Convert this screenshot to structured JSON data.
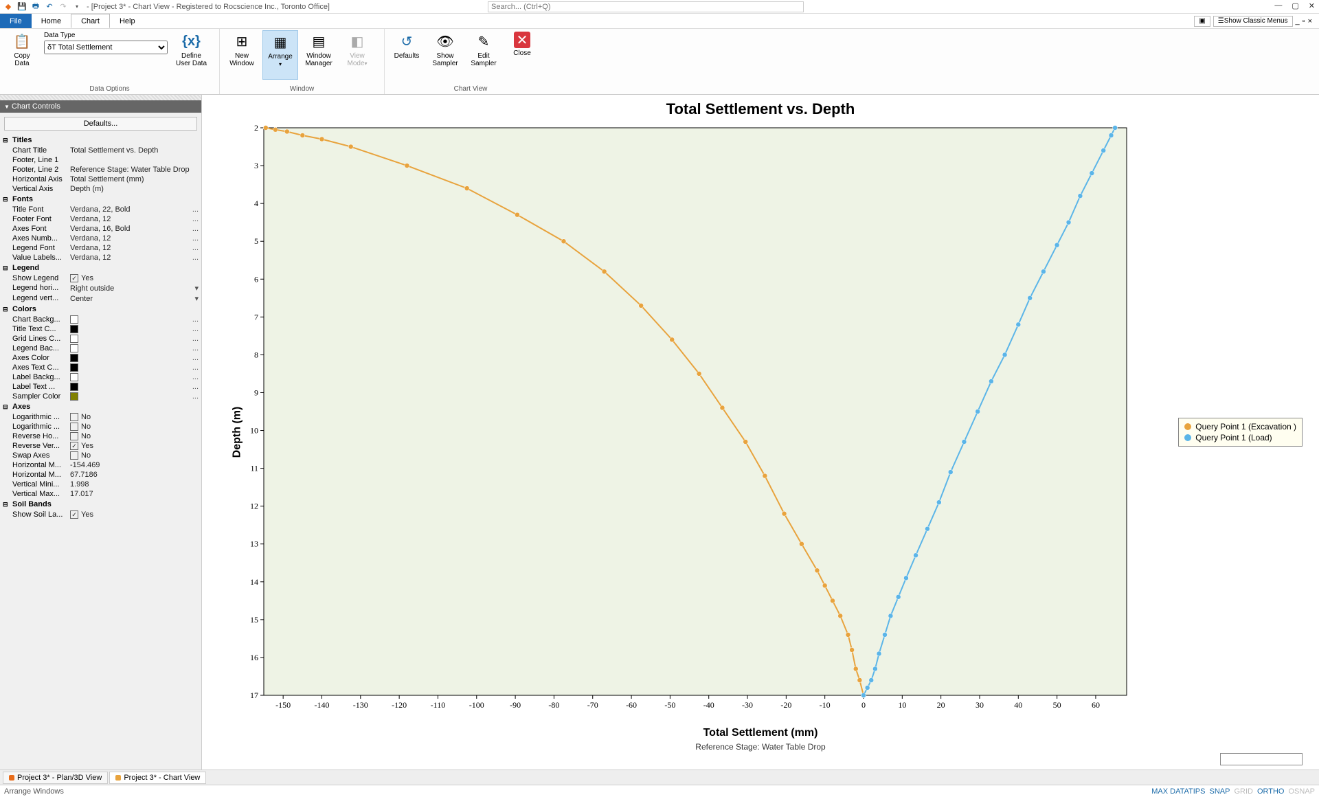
{
  "window": {
    "title": "- [Project 3* - Chart View - Registered to Rocscience Inc., Toronto Office]",
    "search_placeholder": "Search... (Ctrl+Q)"
  },
  "menu": {
    "file": "File",
    "home": "Home",
    "chart": "Chart",
    "help": "Help",
    "show_classic": "Show Classic Menus"
  },
  "ribbon": {
    "copy_data": "Copy\nData",
    "data_type_label": "Data Type",
    "data_type_value": "δT Total Settlement",
    "define_user": "Define\nUser Data",
    "group1": "Data Options",
    "new_window": "New\nWindow",
    "arrange": "Arrange",
    "window_manager": "Window\nManager",
    "view_mode": "View\nMode",
    "group2": "Window",
    "defaults": "Defaults",
    "show_sampler": "Show\nSampler",
    "edit_sampler": "Edit\nSampler",
    "close": "Close",
    "group3": "Chart View"
  },
  "sidebar": {
    "header": "Chart Controls",
    "defaults_btn": "Defaults...",
    "cats": {
      "titles": "Titles",
      "fonts": "Fonts",
      "legend": "Legend",
      "colors": "Colors",
      "axes": "Axes",
      "soil": "Soil Bands"
    },
    "titles": {
      "chart_title_k": "Chart Title",
      "chart_title_v": "Total Settlement vs. Depth",
      "footer1_k": "Footer, Line 1",
      "footer1_v": "",
      "footer2_k": "Footer, Line 2",
      "footer2_v": "Reference Stage: Water Table Drop",
      "haxis_k": "Horizontal Axis",
      "haxis_v": "Total Settlement (mm)",
      "vaxis_k": "Vertical Axis",
      "vaxis_v": "Depth (m)"
    },
    "fonts": {
      "title_k": "Title Font",
      "title_v": "Verdana, 22, Bold",
      "footer_k": "Footer Font",
      "footer_v": "Verdana, 12",
      "axes_k": "Axes Font",
      "axes_v": "Verdana, 16, Bold",
      "nums_k": "Axes Numb...",
      "nums_v": "Verdana, 12",
      "legend_k": "Legend Font",
      "legend_v": "Verdana, 12",
      "vals_k": "Value Labels...",
      "vals_v": "Verdana, 12"
    },
    "legend": {
      "show_k": "Show Legend",
      "show_v": "Yes",
      "horiz_k": "Legend hori...",
      "horiz_v": "Right outside",
      "vert_k": "Legend vert...",
      "vert_v": "Center"
    },
    "colors": {
      "bg_k": "Chart Backg...",
      "title_k": "Title Text C...",
      "grid_k": "Grid Lines C...",
      "legbg_k": "Legend Bac...",
      "axes_k": "Axes Color",
      "axestxt_k": "Axes Text C...",
      "labbg_k": "Label Backg...",
      "labtxt_k": "Label Text ...",
      "sampler_k": "Sampler Color"
    },
    "axes": {
      "logh_k": "Logarithmic ...",
      "logh_v": "No",
      "logv_k": "Logarithmic ...",
      "logv_v": "No",
      "revh_k": "Reverse Ho...",
      "revh_v": "No",
      "revv_k": "Reverse Ver...",
      "revv_v": "Yes",
      "swap_k": "Swap Axes",
      "swap_v": "No",
      "hmin_k": "Horizontal M...",
      "hmin_v": "-154.469",
      "hmax_k": "Horizontal M...",
      "hmax_v": "67.7186",
      "vmin_k": "Vertical Mini...",
      "vmin_v": "1.998",
      "vmax_k": "Vertical Max...",
      "vmax_v": "17.017"
    },
    "soil": {
      "show_k": "Show Soil La...",
      "show_v": "Yes"
    }
  },
  "chart_data": {
    "type": "line",
    "title": "Total Settlement vs. Depth",
    "xlabel": "Total Settlement (mm)",
    "ylabel": "Depth (m)",
    "footer2": "Reference Stage: Water Table Drop",
    "xlim": [
      -155,
      68
    ],
    "ylim": [
      2,
      17
    ],
    "y_reversed": true,
    "x_ticks": [
      -150,
      -140,
      -130,
      -120,
      -110,
      -100,
      -90,
      -80,
      -70,
      -60,
      -50,
      -40,
      -30,
      -20,
      -10,
      0,
      10,
      20,
      30,
      40,
      50,
      60
    ],
    "y_ticks": [
      2,
      3,
      4,
      5,
      6,
      7,
      8,
      9,
      10,
      11,
      12,
      13,
      14,
      15,
      16,
      17
    ],
    "series": [
      {
        "name": "Query Point 1 (Excavation )",
        "color": "#e8a33d",
        "points": [
          {
            "x": -154.5,
            "y": 2.0
          },
          {
            "x": -152.0,
            "y": 2.05
          },
          {
            "x": -149.0,
            "y": 2.1
          },
          {
            "x": -145.0,
            "y": 2.2
          },
          {
            "x": -140.0,
            "y": 2.3
          },
          {
            "x": -132.5,
            "y": 2.5
          },
          {
            "x": -118.0,
            "y": 3.0
          },
          {
            "x": -102.5,
            "y": 3.6
          },
          {
            "x": -89.5,
            "y": 4.3
          },
          {
            "x": -77.5,
            "y": 5.0
          },
          {
            "x": -67.0,
            "y": 5.8
          },
          {
            "x": -57.5,
            "y": 6.7
          },
          {
            "x": -49.5,
            "y": 7.6
          },
          {
            "x": -42.5,
            "y": 8.5
          },
          {
            "x": -36.5,
            "y": 9.4
          },
          {
            "x": -30.5,
            "y": 10.3
          },
          {
            "x": -25.5,
            "y": 11.2
          },
          {
            "x": -20.5,
            "y": 12.2
          },
          {
            "x": -16.0,
            "y": 13.0
          },
          {
            "x": -12.0,
            "y": 13.7
          },
          {
            "x": -10.0,
            "y": 14.1
          },
          {
            "x": -8.0,
            "y": 14.5
          },
          {
            "x": -6.0,
            "y": 14.9
          },
          {
            "x": -4.0,
            "y": 15.4
          },
          {
            "x": -3.0,
            "y": 15.8
          },
          {
            "x": -2.0,
            "y": 16.3
          },
          {
            "x": -1.0,
            "y": 16.6
          },
          {
            "x": 0.0,
            "y": 17.0
          }
        ]
      },
      {
        "name": "Query Point 1 (Load)",
        "color": "#5bb5e8",
        "points": [
          {
            "x": 65.0,
            "y": 2.0
          },
          {
            "x": 64.0,
            "y": 2.2
          },
          {
            "x": 62.0,
            "y": 2.6
          },
          {
            "x": 59.0,
            "y": 3.2
          },
          {
            "x": 56.0,
            "y": 3.8
          },
          {
            "x": 53.0,
            "y": 4.5
          },
          {
            "x": 50.0,
            "y": 5.1
          },
          {
            "x": 46.5,
            "y": 5.8
          },
          {
            "x": 43.0,
            "y": 6.5
          },
          {
            "x": 40.0,
            "y": 7.2
          },
          {
            "x": 36.5,
            "y": 8.0
          },
          {
            "x": 33.0,
            "y": 8.7
          },
          {
            "x": 29.5,
            "y": 9.5
          },
          {
            "x": 26.0,
            "y": 10.3
          },
          {
            "x": 22.5,
            "y": 11.1
          },
          {
            "x": 19.5,
            "y": 11.9
          },
          {
            "x": 16.5,
            "y": 12.6
          },
          {
            "x": 13.5,
            "y": 13.3
          },
          {
            "x": 11.0,
            "y": 13.9
          },
          {
            "x": 9.0,
            "y": 14.4
          },
          {
            "x": 7.0,
            "y": 14.9
          },
          {
            "x": 5.5,
            "y": 15.4
          },
          {
            "x": 4.0,
            "y": 15.9
          },
          {
            "x": 3.0,
            "y": 16.3
          },
          {
            "x": 2.0,
            "y": 16.6
          },
          {
            "x": 1.0,
            "y": 16.8
          },
          {
            "x": 0.0,
            "y": 17.0
          }
        ]
      }
    ],
    "legend": [
      "Query Point 1 (Excavation )",
      "Query Point 1 (Load)"
    ]
  },
  "tabs": {
    "t1": "Project 3* - Plan/3D View",
    "t2": "Project 3* - Chart View"
  },
  "status": {
    "left": "Arrange Windows",
    "maxdt": "MAX DATATIPS",
    "snap": "SNAP",
    "grid": "GRID",
    "ortho": "ORTHO",
    "osnap": "OSNAP"
  }
}
